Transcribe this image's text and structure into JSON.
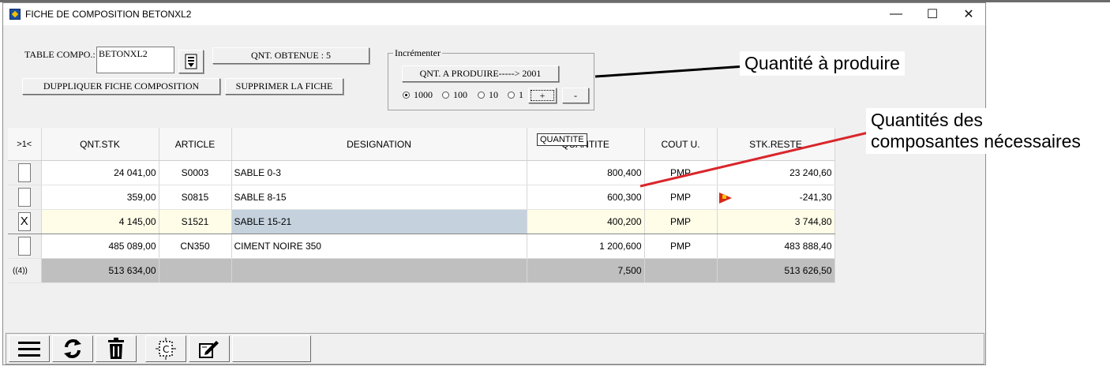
{
  "window": {
    "title": "FICHE DE COMPOSITION BETONXL2",
    "minimize": "—",
    "maximize": "☐",
    "close": "✕"
  },
  "form": {
    "table_compo_label": "TABLE COMPO.:",
    "table_compo_value": "BETONXL2",
    "qnt_obtenue": "QNT. OBTENUE : 5",
    "dupliquer": "DUPPLIQUER FICHE COMPOSITION",
    "supprimer": "SUPPRIMER LA FICHE"
  },
  "incrementer": {
    "legend": "Incrémenter",
    "qnt_a_produire": "QNT. A PRODUIRE----->  2001",
    "options": [
      {
        "label": "1000",
        "selected": true
      },
      {
        "label": "100",
        "selected": false
      },
      {
        "label": "10",
        "selected": false
      },
      {
        "label": "1",
        "selected": false
      }
    ],
    "plus": "+",
    "minus": "-"
  },
  "grid": {
    "headers": [
      ">1<",
      "QNT.STK",
      "ARTICLE",
      "DESIGNATION",
      "QUANTITE",
      "COUT U.",
      "STK.RESTE"
    ],
    "rows": [
      {
        "checked": "",
        "qnt_stk": "24 041,00",
        "article": "S0003",
        "designation": "SABLE 0-3",
        "quantite": "800,400",
        "cout": "PMP",
        "stk_reste": "23 240,60",
        "warning": false
      },
      {
        "checked": "",
        "qnt_stk": "359,00",
        "article": "S0815",
        "designation": "SABLE 8-15",
        "quantite": "600,300",
        "cout": "PMP",
        "stk_reste": "-241,30",
        "warning": true
      },
      {
        "checked": "X",
        "qnt_stk": "4 145,00",
        "article": "S1521",
        "designation": "SABLE 15-21",
        "quantite": "400,200",
        "cout": "PMP",
        "stk_reste": "3 744,80",
        "warning": false
      },
      {
        "checked": "",
        "qnt_stk": "485 089,00",
        "article": "CN350",
        "designation": "CIMENT NOIRE 350",
        "quantite": "1 200,600",
        "cout": "PMP",
        "stk_reste": "483 888,40",
        "warning": false
      }
    ],
    "totals": {
      "count": "((4))",
      "qnt_stk": "513 634,00",
      "quantite": "7,500",
      "stk_reste": "513 626,50"
    },
    "tooltip": "QUANTITE"
  },
  "callouts": {
    "quantite_produire": "Quantité à produire",
    "quantites_composantes_line1": "Quantités des",
    "quantites_composantes_line2": "composantes nécessaires"
  },
  "colors": {
    "selected_cell": "#c5d2de",
    "active_row": "#fffde8",
    "totals_bg": "#bfbfbf",
    "warning_flag": "#d42a1c",
    "red_line": "#d9262c"
  }
}
